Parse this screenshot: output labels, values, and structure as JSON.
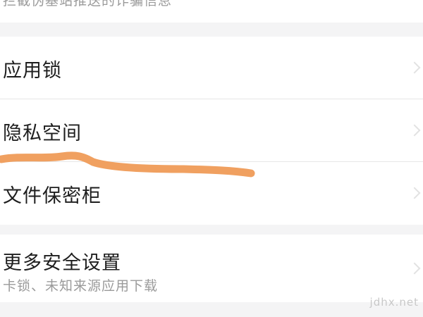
{
  "top_hint": "拦截伪基站推送的诈骗信息",
  "settings": {
    "items": [
      {
        "label": "应用锁"
      },
      {
        "label": "隐私空间"
      },
      {
        "label": "文件保密柜"
      }
    ]
  },
  "more_security": {
    "label": "更多安全设置",
    "subtitle": "卡锁、未知来源应用下载"
  },
  "watermark": "jdhx.net",
  "annotation": {
    "stroke_color": "#f0a060"
  },
  "colors": {
    "background": "#f4f4f5",
    "card": "#ffffff",
    "text_primary": "#1e1e1e",
    "text_secondary": "#9a9a9a"
  }
}
